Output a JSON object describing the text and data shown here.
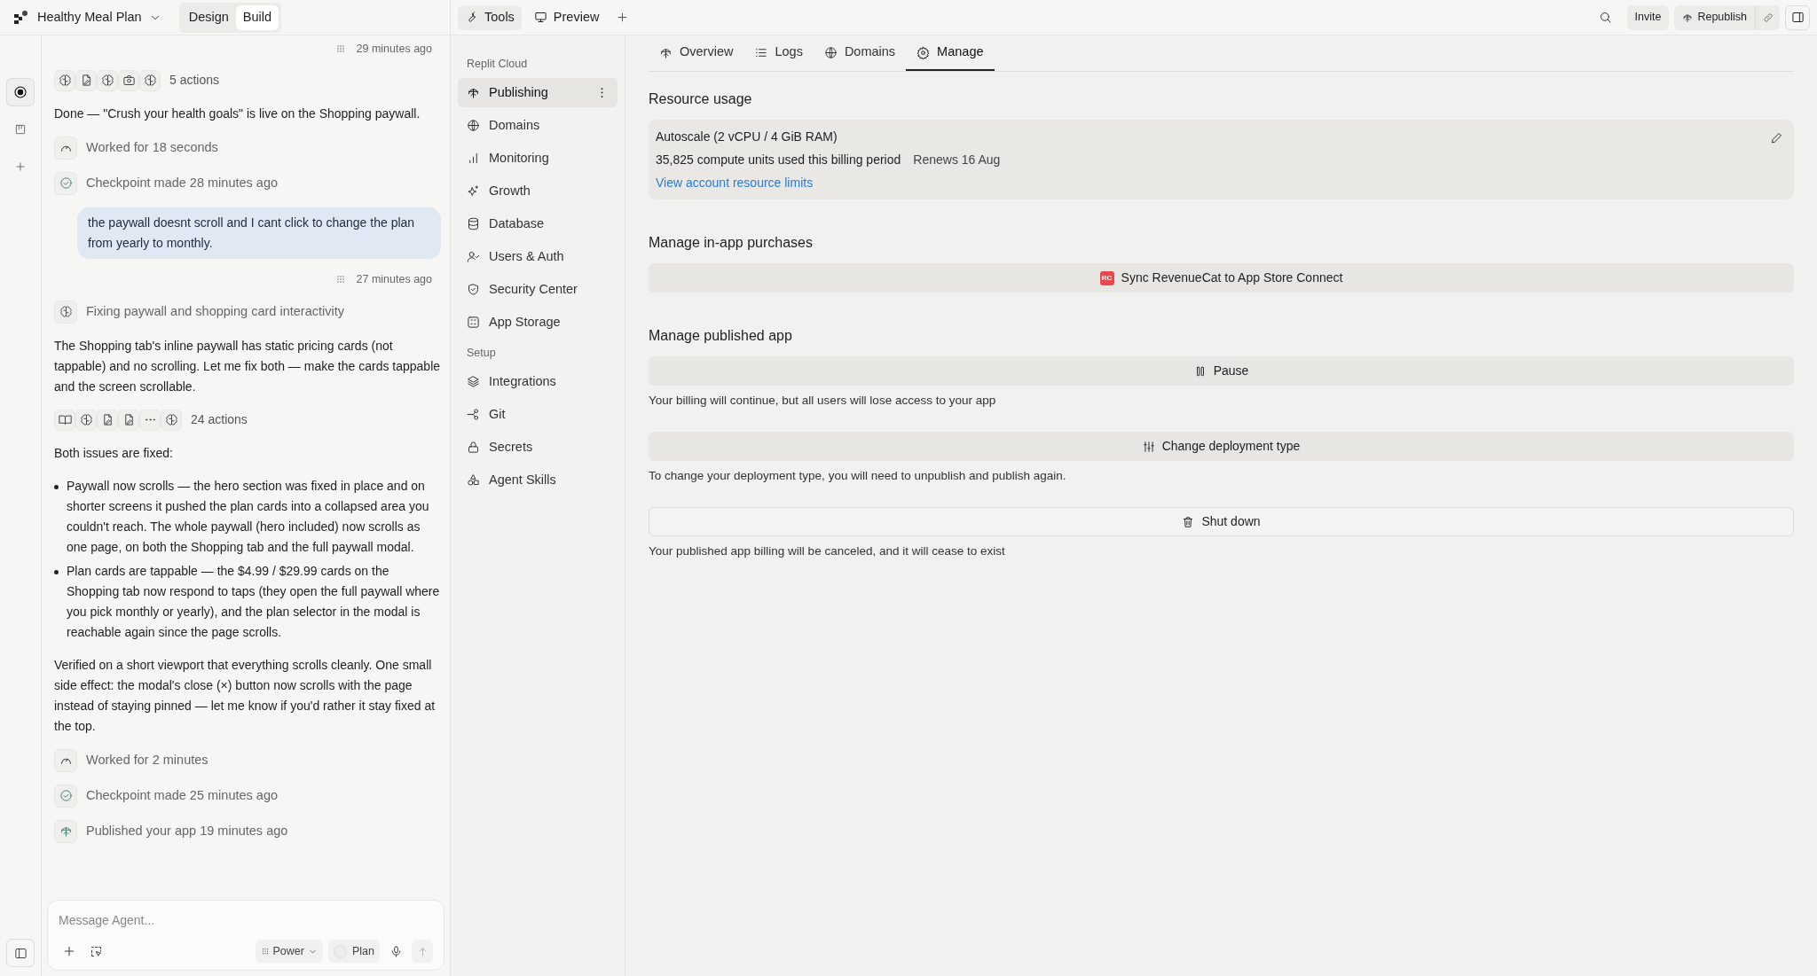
{
  "project": {
    "name": "Healthy Meal Plan"
  },
  "mode_tabs": [
    {
      "label": "Design",
      "selected": false
    },
    {
      "label": "Build",
      "selected": true
    }
  ],
  "rail": [
    {
      "selected": true
    },
    {
      "selected": false
    },
    {
      "selected": false
    }
  ],
  "chat": [
    {
      "kind": "timestamp",
      "text": "29 minutes ago"
    },
    {
      "kind": "actions",
      "text": "5 actions"
    },
    {
      "kind": "paragraph",
      "text": "Done — \"Crush your health goals\" is live on the Shopping paywall."
    },
    {
      "kind": "worked",
      "text": "Worked for 18 seconds"
    },
    {
      "kind": "checkpoint",
      "text": "Checkpoint made 28 minutes ago"
    },
    {
      "kind": "user",
      "text": "the paywall doesnt scroll and I cant click to change the plan from yearly to monthly."
    },
    {
      "kind": "timestamp",
      "text": "27 minutes ago"
    },
    {
      "kind": "task",
      "text": "Fixing paywall and shopping card interactivity"
    },
    {
      "kind": "paragraph",
      "text": "The Shopping tab's inline paywall has static pricing cards (not tappable) and no scrolling. Let me fix both — make the cards tappable and the screen scrollable."
    },
    {
      "kind": "actions",
      "text": "24 actions"
    },
    {
      "kind": "paragraph",
      "text": "Both issues are fixed:"
    },
    {
      "kind": "bullets",
      "items": [
        "Paywall now scrolls — the hero section was fixed in place and on shorter screens it pushed the plan cards into a collapsed area you couldn't reach. The whole paywall (hero included) now scrolls as one page, on both the Shopping tab and the full paywall modal.",
        "Plan cards are tappable — the $4.99 / $29.99 cards on the Shopping tab now respond to taps (they open the full paywall where you pick monthly or yearly), and the plan selector in the modal is reachable again since the page scrolls."
      ]
    },
    {
      "kind": "paragraph",
      "text": "Verified on a short viewport that everything scrolls cleanly. One small side effect: the modal's close (×) button now scrolls with the page instead of staying pinned — let me know if you'd rather it stay fixed at the top."
    },
    {
      "kind": "worked",
      "text": "Worked for 2 minutes"
    },
    {
      "kind": "checkpoint",
      "text": "Checkpoint made 25 minutes ago"
    },
    {
      "kind": "published",
      "text": "Published your app 19 minutes ago"
    }
  ],
  "composer": {
    "placeholder": "Message Agent...",
    "mode": "Power",
    "plan": {
      "label": "Plan",
      "on": false
    }
  },
  "top_tabs": [
    {
      "label": "Tools",
      "selected": true
    },
    {
      "label": "Preview",
      "selected": false
    }
  ],
  "header_actions": {
    "invite": "Invite",
    "republish": "Republish"
  },
  "sidebar": [
    {
      "title": "Replit Cloud",
      "items": [
        {
          "label": "Publishing",
          "selected": true
        },
        {
          "label": "Domains",
          "selected": false
        },
        {
          "label": "Monitoring",
          "selected": false
        },
        {
          "label": "Growth",
          "selected": false
        },
        {
          "label": "Database",
          "selected": false
        },
        {
          "label": "Users & Auth",
          "selected": false
        },
        {
          "label": "Security Center",
          "selected": false
        },
        {
          "label": "App Storage",
          "selected": false
        }
      ]
    },
    {
      "title": "Setup",
      "items": [
        {
          "label": "Integrations",
          "selected": false
        },
        {
          "label": "Git",
          "selected": false
        },
        {
          "label": "Secrets",
          "selected": false
        },
        {
          "label": "Agent Skills",
          "selected": false
        }
      ]
    }
  ],
  "content_tabs": [
    {
      "label": "Overview",
      "selected": false
    },
    {
      "label": "Logs",
      "selected": false
    },
    {
      "label": "Domains",
      "selected": false
    },
    {
      "label": "Manage",
      "selected": true
    }
  ],
  "resource_usage": {
    "title": "Resource usage",
    "plan": "Autoscale (2 vCPU / 4 GiB RAM)",
    "usage": "35,825 compute units used this billing period",
    "renews": "Renews 16 Aug",
    "link": "View account resource limits"
  },
  "in_app_purchases": {
    "title": "Manage in-app purchases",
    "logo": "RC",
    "button": "Sync RevenueCat to App Store Connect"
  },
  "published_app": {
    "title": "Manage published app",
    "actions": [
      {
        "kind": "pause",
        "label": "Pause",
        "note": "Your billing will continue, but all users will lose access to your app"
      },
      {
        "kind": "change",
        "label": "Change deployment type",
        "note": "To change your deployment type, you will need to unpublish and publish again."
      },
      {
        "kind": "shutdown",
        "label": "Shut down",
        "note": "Your published app billing will be canceled, and it will cease to exist"
      }
    ]
  }
}
